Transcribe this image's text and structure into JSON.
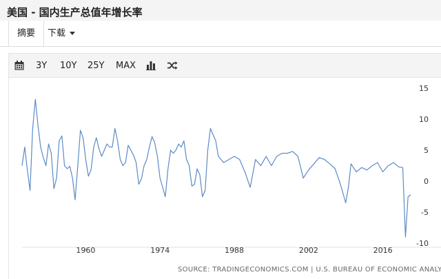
{
  "header": {
    "title": "美国 - 国内生产总值年增长率"
  },
  "tabs": [
    {
      "label": "摘要"
    },
    {
      "label": "下载"
    }
  ],
  "toolbar": {
    "calendar_icon": "calendar-icon",
    "ranges": [
      {
        "label": "3Y"
      },
      {
        "label": "10Y"
      },
      {
        "label": "25Y"
      },
      {
        "label": "MAX"
      }
    ],
    "bar_chart_icon": "bar-chart-icon",
    "shuffle_icon": "shuffle-icon"
  },
  "source": "SOURCE: TRADINGECONOMICS.COM | U.S. BUREAU OF ECONOMIC ANALYSIS",
  "colors": {
    "line": "#5b8ac5",
    "header_bg": "#f4f4f4"
  },
  "chart_data": {
    "type": "line",
    "xlabel": "",
    "ylabel": "",
    "ylim": [
      -10,
      15
    ],
    "xlim": [
      1948,
      2021.5
    ],
    "grid": false,
    "y_axis_position": "right",
    "x_ticks": [
      "1960",
      "1974",
      "1988",
      "2002",
      "2016"
    ],
    "x_tick_values": [
      1960,
      1974,
      1988,
      2002,
      2016
    ],
    "y_ticks": [
      "15",
      "10",
      "5",
      "0",
      "-5",
      "-10"
    ],
    "y_tick_values": [
      15,
      10,
      5,
      0,
      -5,
      -10
    ],
    "series": [
      {
        "x": [
          1948,
          1948.5,
          1949,
          1949.5,
          1950,
          1950.5,
          1951,
          1951.5,
          1952,
          1952.5,
          1953,
          1953.5,
          1954,
          1954.5,
          1955,
          1955.5,
          1956,
          1956.5,
          1957,
          1957.5,
          1958,
          1958.5,
          1959,
          1959.5,
          1960,
          1960.5,
          1961,
          1961.5,
          1962,
          1962.5,
          1963,
          1963.5,
          1964,
          1964.5,
          1965,
          1965.5,
          1966,
          1966.5,
          1967,
          1967.5,
          1968,
          1968.5,
          1969,
          1969.5,
          1970,
          1970.5,
          1971,
          1971.5,
          1972,
          1972.5,
          1973,
          1973.5,
          1974,
          1974.5,
          1975,
          1975.5,
          1976,
          1976.5,
          1977,
          1977.5,
          1978,
          1978.5,
          1979,
          1979.5,
          1980,
          1980.5,
          1981,
          1981.5,
          1982,
          1982.5,
          1983,
          1983.5,
          1984,
          1984.5,
          1985,
          1986,
          1987,
          1988,
          1989,
          1990,
          1991,
          1992,
          1993,
          1994,
          1995,
          1996,
          1997,
          1998,
          1999,
          2000,
          2001,
          2002,
          2003,
          2004,
          2005,
          2006,
          2007,
          2008,
          2008.5,
          2009,
          2009.5,
          2010,
          2011,
          2012,
          2013,
          2014,
          2015,
          2016,
          2017,
          2018,
          2019,
          2019.75,
          2020.25,
          2020.75,
          2021.25
        ],
        "values": [
          2.5,
          5.5,
          1.8,
          -1.5,
          8.5,
          13.2,
          9.0,
          5.5,
          3.8,
          2.5,
          6.0,
          4.5,
          -1.2,
          0.5,
          6.5,
          7.3,
          2.5,
          2.0,
          2.4,
          0.5,
          -3.0,
          2.5,
          8.2,
          7.0,
          3.5,
          0.8,
          1.8,
          5.5,
          7.0,
          5.2,
          4.0,
          5.0,
          6.0,
          5.5,
          5.5,
          8.5,
          6.5,
          3.5,
          2.5,
          3.0,
          5.8,
          5.0,
          4.2,
          3.0,
          -0.5,
          0.4,
          2.5,
          3.5,
          5.5,
          7.2,
          6.2,
          4.0,
          0.5,
          -1.0,
          -2.5,
          2.0,
          5.0,
          4.5,
          5.0,
          6.0,
          5.5,
          6.5,
          3.5,
          2.5,
          -0.8,
          -0.5,
          2.0,
          1.0,
          -2.5,
          -1.5,
          5.0,
          8.5,
          7.5,
          6.5,
          4.0,
          3.0,
          3.5,
          4.0,
          3.5,
          1.5,
          -1.0,
          3.5,
          2.5,
          4.0,
          2.5,
          4.0,
          4.5,
          4.5,
          4.8,
          4.0,
          0.5,
          1.8,
          2.8,
          3.8,
          3.5,
          2.8,
          2.0,
          -0.5,
          -2.0,
          -3.5,
          -1.0,
          2.8,
          1.5,
          2.2,
          1.8,
          2.5,
          3.0,
          1.5,
          2.5,
          3.0,
          2.3,
          2.2,
          -9.0,
          -2.5,
          -2.2
        ]
      }
    ]
  }
}
